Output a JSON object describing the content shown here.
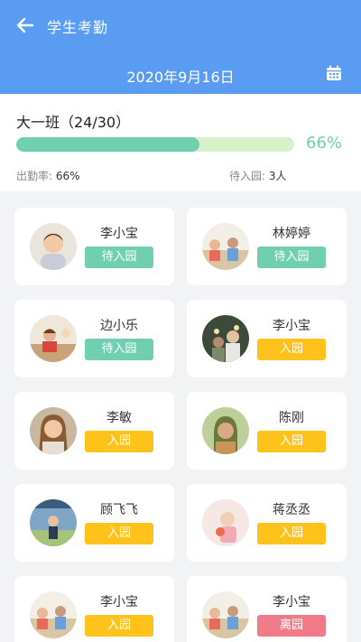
{
  "header": {
    "title": "学生考勤",
    "date": "2020年9月16日",
    "back_icon": "arrow-left-icon",
    "calendar_icon": "calendar-icon"
  },
  "summary": {
    "class_label": "大一班（24/30）",
    "progress": 0.66,
    "progress_text": "66%",
    "attendance_rate_label": "出勤率:",
    "attendance_rate_value": "66%",
    "pending_label": "待入园:",
    "pending_value": "3人"
  },
  "colors": {
    "primary": "#5b9cf3",
    "pending": "#6fcfb0",
    "entered": "#ffc21a",
    "left": "#f07a87"
  },
  "students": [
    {
      "name": "李小宝",
      "status": "待入园",
      "kind": "pending"
    },
    {
      "name": "林婷婷",
      "status": "待入园",
      "kind": "pending"
    },
    {
      "name": "边小乐",
      "status": "待入园",
      "kind": "pending"
    },
    {
      "name": "李小宝",
      "status": "入园",
      "kind": "in"
    },
    {
      "name": "李敏",
      "status": "入园",
      "kind": "in"
    },
    {
      "name": "陈刚",
      "status": "入园",
      "kind": "in"
    },
    {
      "name": "顾飞飞",
      "status": "入园",
      "kind": "in"
    },
    {
      "name": "蒋丞丞",
      "status": "入园",
      "kind": "in"
    },
    {
      "name": "李小宝",
      "status": "入园",
      "kind": "in"
    },
    {
      "name": "李小宝",
      "status": "离园",
      "kind": "out"
    }
  ]
}
